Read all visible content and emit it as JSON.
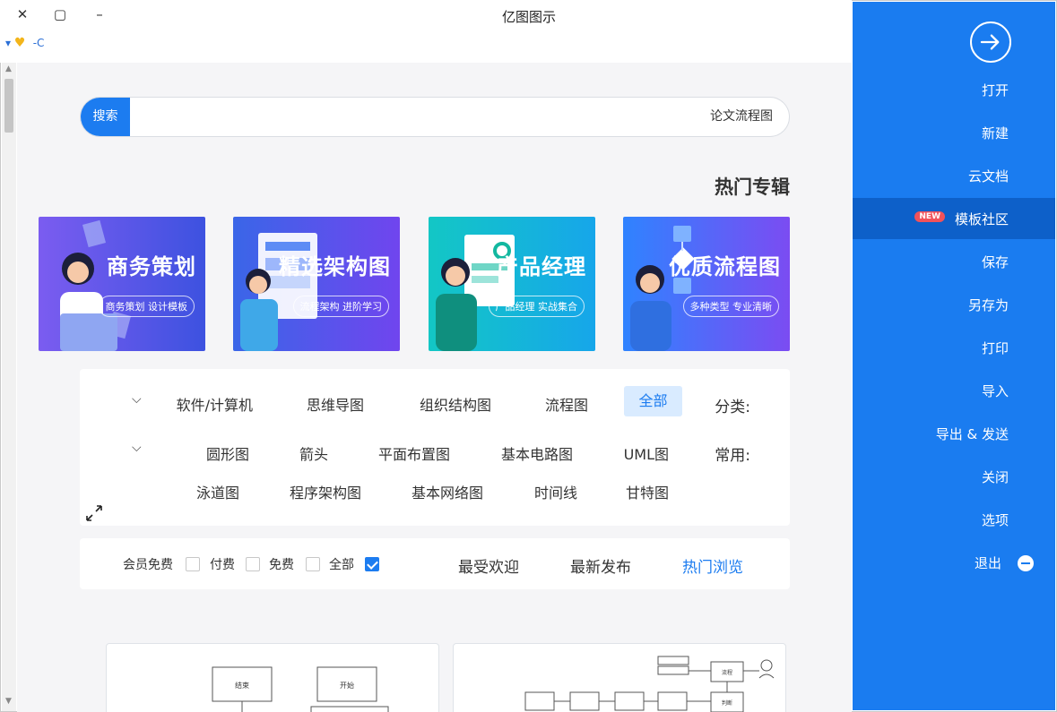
{
  "window": {
    "title": "亿图图示",
    "close": "✕",
    "maximize": "▢",
    "minimize": "–"
  },
  "toolbar": {
    "crumb": "-C",
    "dropdown": "▾"
  },
  "search": {
    "button": "搜索",
    "value": "论文流程图"
  },
  "section": {
    "title": "热门专辑"
  },
  "banners": [
    {
      "title": "商务策划",
      "subtitle": "商务策划 设计模板",
      "colors": [
        "#7b5cf0",
        "#3d52e0"
      ]
    },
    {
      "title": "精选架构图",
      "subtitle": "流程架构 进阶学习",
      "colors": [
        "#7045ee",
        "#3a66e8"
      ]
    },
    {
      "title": "产品经理",
      "subtitle": "产品经理 实战集合",
      "colors": [
        "#13c7c5",
        "#16a6ea"
      ]
    },
    {
      "title": "优质流程图",
      "subtitle": "多种类型 专业清晰",
      "colors": [
        "#2f83ff",
        "#7b4cf2"
      ]
    }
  ],
  "categories": {
    "label": "分类:",
    "items": [
      "全部",
      "流程图",
      "组织结构图",
      "思维导图",
      "软件/计算机"
    ],
    "active": "全部",
    "common_label": "常用:",
    "common_row1": [
      "UML图",
      "基本电路图",
      "平面布置图",
      "箭头",
      "圆形图"
    ],
    "common_row2": [
      "甘特图",
      "时间线",
      "基本网络图",
      "程序架构图",
      "泳道图"
    ]
  },
  "filters": {
    "tabs": [
      "热门浏览",
      "最新发布",
      "最受欢迎"
    ],
    "active_tab": "热门浏览",
    "checks": [
      {
        "label": "全部",
        "checked": true
      },
      {
        "label": "免费",
        "checked": false
      },
      {
        "label": "付费",
        "checked": false
      },
      {
        "label": "会员免费",
        "checked": false
      }
    ]
  },
  "cards": [
    {
      "node_a": "开始",
      "node_b": "结束"
    },
    {
      "node_a": "流程",
      "node_b": "判断"
    }
  ],
  "sidebar": {
    "items": [
      "打开",
      "新建",
      "云文档",
      "模板社区",
      "保存",
      "另存为",
      "打印",
      "导入",
      "导出 & 发送",
      "关闭",
      "选项",
      "退出"
    ],
    "active": "模板社区",
    "new_badge": "NEW"
  }
}
